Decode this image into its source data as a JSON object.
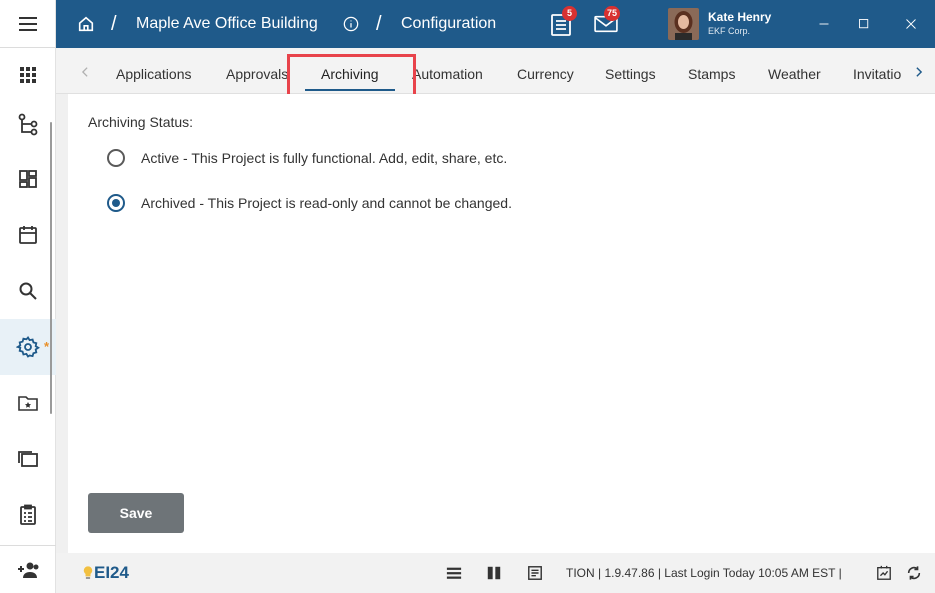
{
  "header": {
    "breadcrumb_project": "Maple Ave Office Building",
    "breadcrumb_page": "Configuration",
    "separator": "/",
    "tasks_badge": "5",
    "mail_badge": "75",
    "user_name": "Kate Henry",
    "user_org": "EKF Corp.",
    "accent_color": "#1f5a8a"
  },
  "tabs": [
    {
      "label": "Applications"
    },
    {
      "label": "Approvals"
    },
    {
      "label": "Archiving"
    },
    {
      "label": "Automation"
    },
    {
      "label": "Currency"
    },
    {
      "label": "Settings"
    },
    {
      "label": "Stamps"
    },
    {
      "label": "Weather"
    },
    {
      "label": "Invitatio"
    }
  ],
  "active_tab": "Archiving",
  "content": {
    "status_label": "Archiving Status:",
    "options": [
      {
        "label": "Active - This Project is fully functional.  Add, edit, share, etc.",
        "checked": false
      },
      {
        "label": "Archived - This Project is read-only and cannot be changed.",
        "checked": true
      }
    ],
    "save_label": "Save"
  },
  "footer": {
    "logo_text": "EI24",
    "status_text": "TION  |  1.9.47.86  |  Last Login Today 10:05 AM EST  |"
  },
  "rail": {
    "items": [
      "menu-icon",
      "apps-grid-icon",
      "tree-icon",
      "dashboard-icon",
      "calendar-icon",
      "search-icon",
      "gear-icon",
      "starred-folder-icon",
      "folders-icon",
      "clipboard-icon",
      "add-user-icon"
    ],
    "active_item": "gear-icon"
  }
}
